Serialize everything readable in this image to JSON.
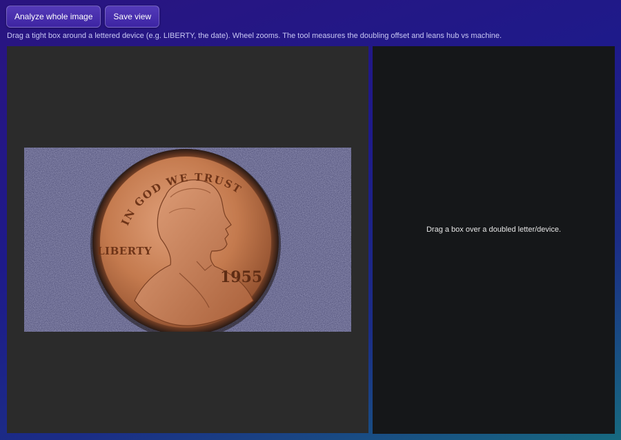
{
  "toolbar": {
    "analyze_label": "Analyze whole image",
    "save_label": "Save view"
  },
  "hint": {
    "text": "Drag a tight box around a lettered device (e.g. LIBERTY, the date). Wheel zooms. The tool measures the doubling offset and leans hub vs machine."
  },
  "coin": {
    "motto": "IN GOD WE TRUST",
    "liberty": "LIBERTY",
    "year": "1955"
  },
  "analysis": {
    "empty_message": "Drag a box over a doubled letter/device."
  },
  "colors": {
    "left_panel_bg": "#2b2b2b",
    "right_panel_bg": "#151719",
    "coin_copper": "#c47a4e",
    "background_fabric": "#5a5a86"
  }
}
